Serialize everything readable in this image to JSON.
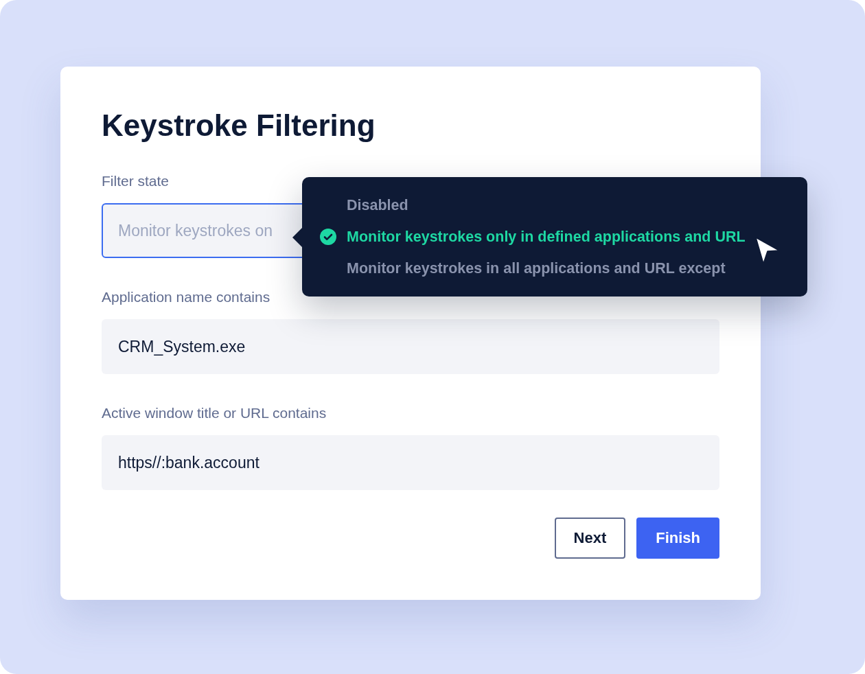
{
  "title": "Keystroke Filtering",
  "fields": [
    {
      "kind": "select",
      "label": "Filter state",
      "value": "Monitor keystrokes on",
      "focused": true
    },
    {
      "kind": "text",
      "label": "Application name contains",
      "value": "CRM_System.exe",
      "focused": false
    },
    {
      "kind": "text",
      "label": "Active window title or URL contains",
      "value": "https//:bank.account",
      "focused": false
    }
  ],
  "dropdown": {
    "options": [
      {
        "label": "Disabled",
        "selected": false
      },
      {
        "label": "Monitor keystrokes only in defined applications and URL",
        "selected": true
      },
      {
        "label": "Monitor keystrokes in all applications and URL except",
        "selected": false
      }
    ]
  },
  "buttons": [
    {
      "label": "Next",
      "kind": "secondary"
    },
    {
      "label": "Finish",
      "kind": "primary"
    }
  ]
}
